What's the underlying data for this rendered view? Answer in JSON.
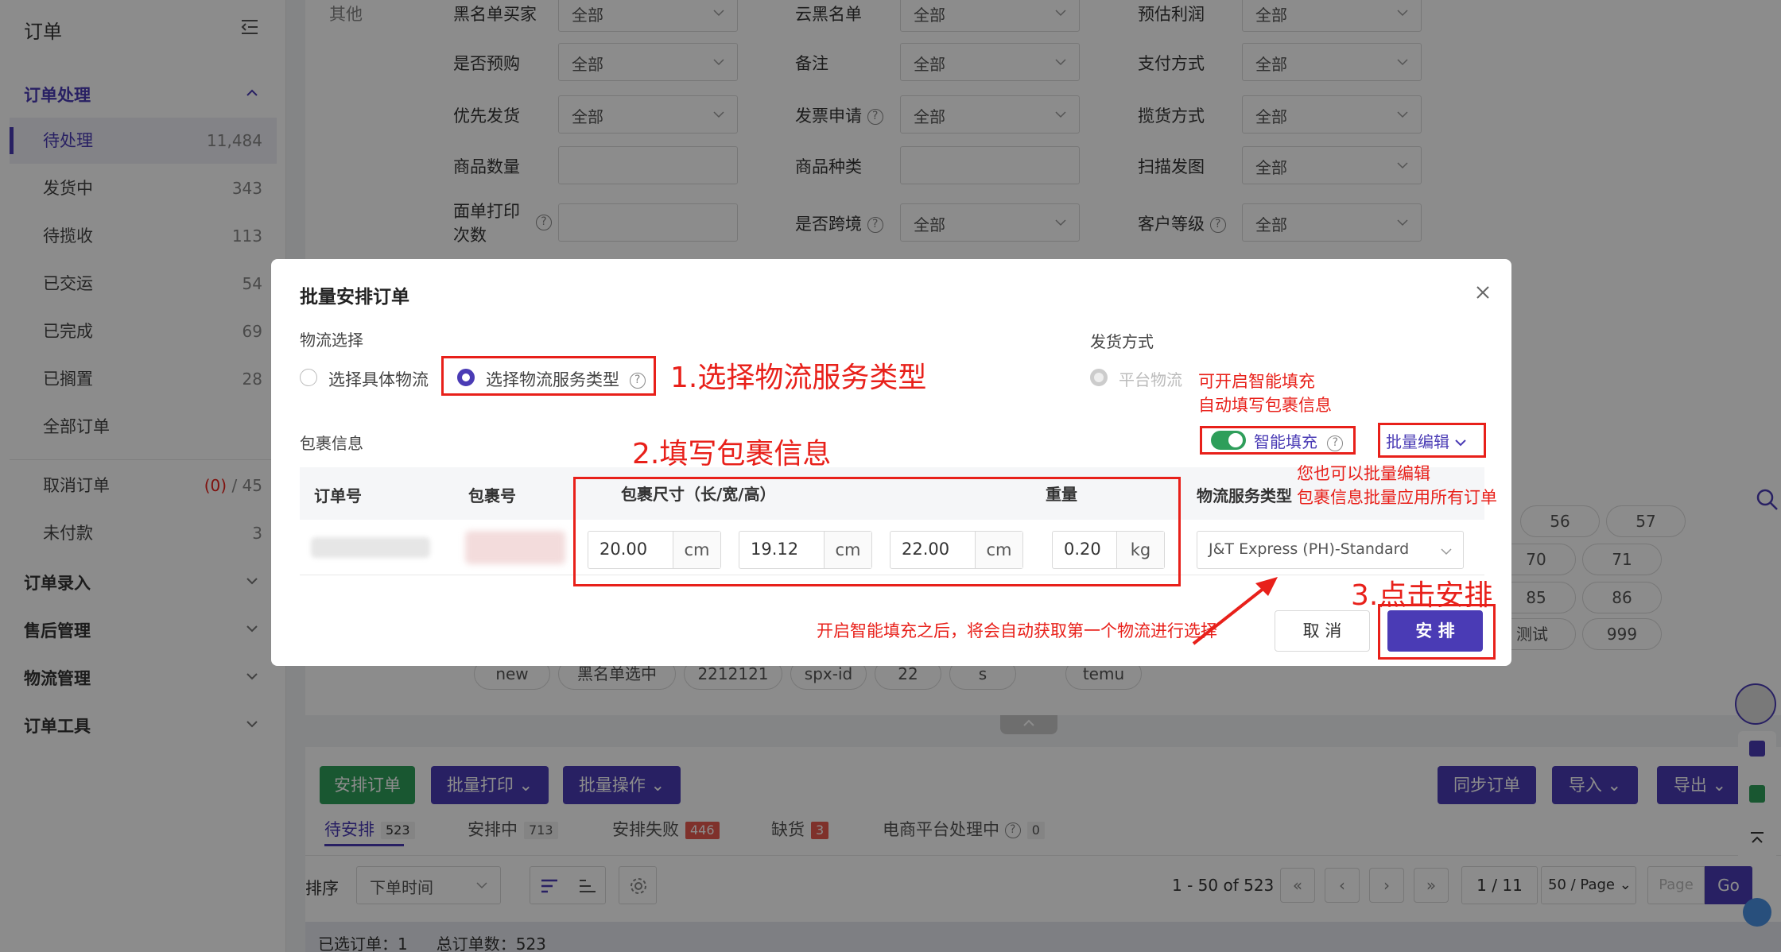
{
  "sidebar": {
    "title": "订单",
    "groups": [
      {
        "label": "订单处理"
      },
      {
        "label": "订单录入"
      },
      {
        "label": "售后管理"
      },
      {
        "label": "物流管理"
      },
      {
        "label": "订单工具"
      }
    ],
    "items": [
      {
        "label": "待处理",
        "count": "11,484"
      },
      {
        "label": "发货中",
        "count": "343"
      },
      {
        "label": "待揽收",
        "count": "113"
      },
      {
        "label": "已交运",
        "count": "54"
      },
      {
        "label": "已完成",
        "count": "69"
      },
      {
        "label": "已搁置",
        "count": "28"
      },
      {
        "label": "全部订单",
        "count": ""
      },
      {
        "label": "取消订单",
        "count_red": "(0)",
        "count_rest": " / 45"
      },
      {
        "label": "未付款",
        "count": "3"
      }
    ]
  },
  "filters": {
    "other_label": "其他",
    "all": "全部",
    "col1": [
      "黑名单买家",
      "是否预购",
      "优先发货",
      "商品数量",
      "面单打印",
      "次数"
    ],
    "col2": [
      "云黑名单",
      "备注",
      "发票申请",
      "商品种类",
      "是否跨境"
    ],
    "col3": [
      "预估利润",
      "支付方式",
      "揽货方式",
      "扫描发图",
      "客户等级"
    ]
  },
  "tags": [
    "56",
    "57",
    "70",
    "71",
    "85",
    "86",
    "测试",
    "999",
    "new",
    "黑名单选中",
    "2212121",
    "spx-id",
    "22",
    "s",
    "temu"
  ],
  "toolbar": {
    "arrange": "安排订单",
    "batch_print": "批量打印",
    "batch_ops": "批量操作",
    "sync": "同步订单",
    "import": "导入",
    "export": "导出"
  },
  "tabs": [
    {
      "label": "待安排",
      "count": "523"
    },
    {
      "label": "安排中",
      "count": "713"
    },
    {
      "label": "安排失败",
      "count": "446"
    },
    {
      "label": "缺货",
      "count": "3"
    },
    {
      "label": "电商平台处理中",
      "count": "0"
    }
  ],
  "sort": {
    "label": "排序",
    "value": "下单时间"
  },
  "pagination": {
    "range": "1 - 50 of 523",
    "page": "1 / 11",
    "per_page": "50 / Page",
    "page_placeholder": "Page",
    "go": "Go"
  },
  "footer": {
    "selected": "已选订单：1",
    "total": "总订单数：523"
  },
  "modal": {
    "title": "批量安排订单",
    "logistics_label": "物流选择",
    "option_specific": "选择具体物流",
    "option_service": "选择物流服务类型",
    "ship_method_label": "发货方式",
    "ship_method_value": "平台物流",
    "package_label": "包裹信息",
    "smart_fill": "智能填充",
    "batch_edit": "批量编辑",
    "columns": {
      "order": "订单号",
      "package": "包裹号",
      "size": "包裹尺寸（长/宽/高）",
      "weight": "重量",
      "service": "物流服务类型"
    },
    "row": {
      "length": "20.00",
      "width": "19.12",
      "height": "22.00",
      "cm": "cm",
      "weight": "0.20",
      "kg": "kg",
      "service": "J&T Express (PH)-Standard"
    },
    "cancel": "取 消",
    "confirm": "安 排"
  },
  "annotations": {
    "step1": "1.选择物流服务类型",
    "step2": "2.填写包裹信息",
    "step3": "3.点击安排",
    "smart_note_1": "可开启智能填充",
    "smart_note_2": "自动填写包裹信息",
    "batch_note_1": "您也可以批量编辑",
    "batch_note_2": "包裹信息批量应用所有订单",
    "auto_note": "开启智能填充之后，将会自动获取第一个物流进行选择"
  },
  "colors": {
    "primary": "#4a3bb5",
    "green": "#2e9e5a",
    "red": "#e8201a"
  }
}
